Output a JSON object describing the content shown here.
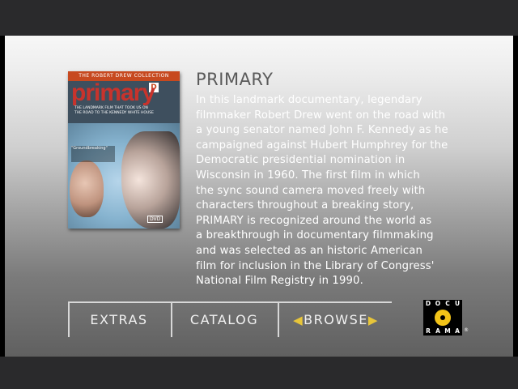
{
  "dvd": {
    "series": "THE ROBERT DREW COLLECTION",
    "title": "primary",
    "tagline": "THE LANDMARK FILM THAT TOOK US ON THE ROAD TO THE KENNEDY WHITE HOUSE",
    "quote": "\"Groundbreaking\"",
    "rating": "DVD"
  },
  "film": {
    "title": "PRIMARY",
    "description": "In this landmark documentary, legendary\nfilmmaker Robert Drew went on the road with\na young senator named John F. Kennedy as he\ncampaigned against Hubert Humphrey for the\nDemocratic presidential nomination in\nWisconsin in 1960. The first film in which\nthe sync sound camera moved freely with\ncharacters throughout a breaking story,\nPRIMARY is recognized around the world as\na breakthrough in documentary filmmaking\nand was selected as an historic American\nfilm for inclusion in the Library of Congress'\nNational Film Registry in 1990."
  },
  "menu": {
    "extras": "EXTRAS",
    "catalog": "CATALOG",
    "browse": "BROWSE",
    "arrow_left": "◀",
    "arrow_right": "▶"
  },
  "logo": {
    "letters": [
      "D",
      "O",
      "C",
      "U",
      "R",
      "A",
      "M",
      "A"
    ],
    "reg": "®"
  },
  "colors": {
    "accent_arrow": "#e7c53a",
    "logo_disc": "#f2c318",
    "cover_title": "#c8332c"
  }
}
